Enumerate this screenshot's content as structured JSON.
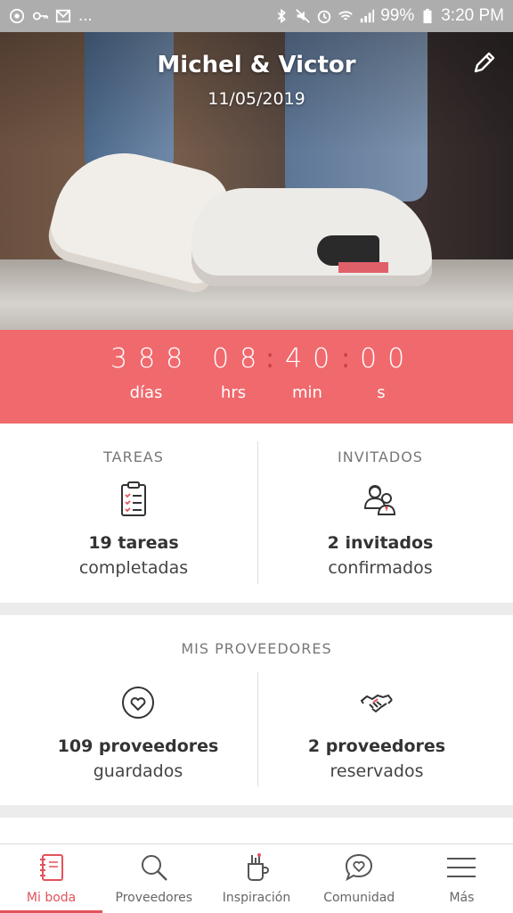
{
  "status_bar": {
    "left_icons": [
      "whatsapp-icon",
      "key-icon",
      "gmail-icon",
      "more-icon"
    ],
    "more_text": "...",
    "right_icons": [
      "bluetooth-icon",
      "mute-icon",
      "alarm-icon",
      "wifi-icon",
      "signal-icon",
      "battery-icon"
    ],
    "battery": "99%",
    "time": "3:20 PM"
  },
  "hero": {
    "title": "Michel & Victor",
    "date": "11/05/2019",
    "edit_icon": "pencil-icon"
  },
  "countdown": {
    "days": "388",
    "hours": "08",
    "minutes": "40",
    "seconds": "00",
    "labels": {
      "days": "días",
      "hours": "hrs",
      "minutes": "min",
      "seconds": "s"
    },
    "colors": {
      "background": "#f0696d",
      "colon": "#c93d44"
    }
  },
  "summary": {
    "tasks": {
      "heading": "TAREAS",
      "count": "19 tareas",
      "sub": "completadas",
      "icon": "clipboard-checklist-icon"
    },
    "guests": {
      "heading": "INVITADOS",
      "count": "2 invitados",
      "sub": "confirmados",
      "icon": "couple-icon"
    }
  },
  "providers": {
    "heading": "MIS PROVEEDORES",
    "saved": {
      "count": "109 proveedores",
      "sub": "guardados",
      "icon": "heart-circle-icon"
    },
    "booked": {
      "count": "2 proveedores",
      "sub": "reservados",
      "icon": "handshake-icon"
    }
  },
  "bottom_nav": {
    "active_color": "#e2535c",
    "items": [
      {
        "label": "Mi boda",
        "icon": "notebook-icon",
        "active": true
      },
      {
        "label": "Proveedores",
        "icon": "search-icon",
        "active": false
      },
      {
        "label": "Inspiración",
        "icon": "inspiration-icon",
        "active": false
      },
      {
        "label": "Comunidad",
        "icon": "chat-heart-icon",
        "active": false
      },
      {
        "label": "Más",
        "icon": "menu-icon",
        "active": false
      }
    ]
  }
}
